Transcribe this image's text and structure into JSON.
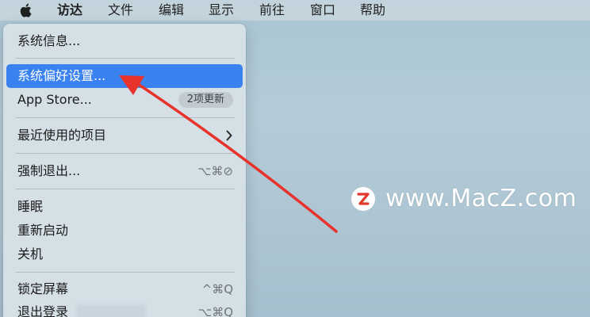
{
  "menubar": {
    "apple_icon": "apple-logo-icon",
    "items": [
      {
        "label": "访达"
      },
      {
        "label": "文件"
      },
      {
        "label": "编辑"
      },
      {
        "label": "显示"
      },
      {
        "label": "前往"
      },
      {
        "label": "窗口"
      },
      {
        "label": "帮助"
      }
    ]
  },
  "apple_menu": {
    "items": [
      {
        "label": "系统信息..."
      },
      {
        "label": "系统偏好设置...",
        "selected": true
      },
      {
        "label": "App Store...",
        "badge": "2项更新"
      },
      {
        "label": "最近使用的项目",
        "submenu_icon": "chevron-right-icon"
      },
      {
        "label": "强制退出...",
        "shortcut": "⌥⌘⊘"
      },
      {
        "label": "睡眠"
      },
      {
        "label": "重新启动"
      },
      {
        "label": "关机"
      },
      {
        "label": "锁定屏幕",
        "shortcut": "^⌘Q"
      },
      {
        "label": "退出登录",
        "shortcut": "⌥⌘Q"
      }
    ]
  },
  "watermark": {
    "logo_icon": "macz-logo-icon",
    "text": "www.MacZ.com"
  },
  "colors": {
    "selection": "#3a82f0",
    "arrow": "#e8322c",
    "watermark_logo": "#e23a2e"
  }
}
